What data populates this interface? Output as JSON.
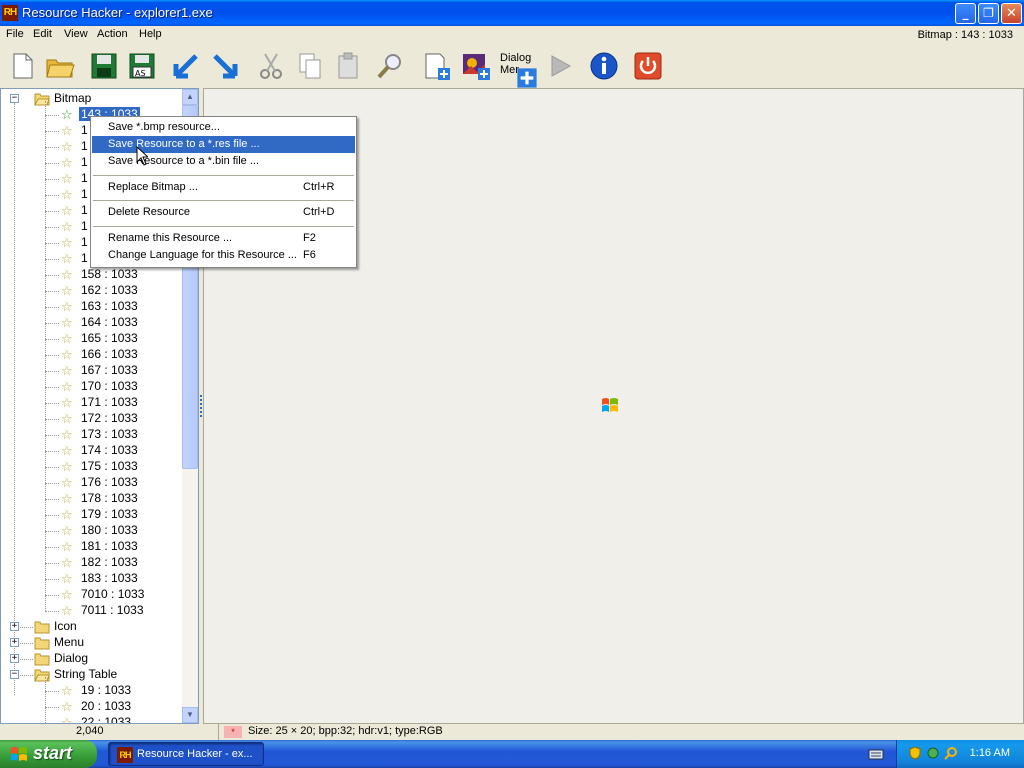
{
  "window": {
    "title": "Resource Hacker - explorer1.exe",
    "icon_text": "RH",
    "controls": {
      "minimize": "_",
      "maximize": "❐",
      "close": "✕"
    }
  },
  "menubar": {
    "items": [
      "File",
      "Edit",
      "View",
      "Action",
      "Help"
    ],
    "status": "Bitmap : 143 : 1033"
  },
  "toolbar": {
    "dialog_label_line1": "Dialog",
    "dialog_label_line2": "Mer"
  },
  "tree": {
    "root_folder": "Bitmap",
    "selected_item": "143 : 1033",
    "bitmap_items_visible": [
      "158 : 1033",
      "162 : 1033",
      "163 : 1033",
      "164 : 1033",
      "165 : 1033",
      "166 : 1033",
      "167 : 1033",
      "170 : 1033",
      "171 : 1033",
      "172 : 1033",
      "173 : 1033",
      "174 : 1033",
      "175 : 1033",
      "176 : 1033",
      "178 : 1033",
      "179 : 1033",
      "180 : 1033",
      "181 : 1033",
      "182 : 1033",
      "183 : 1033",
      "7010 : 1033",
      "7011 : 1033"
    ],
    "partially_hidden_prefixes": [
      "1",
      "1",
      "1",
      "1",
      "1",
      "1",
      "1",
      "1",
      "1"
    ],
    "folders": [
      "Icon",
      "Menu",
      "Dialog",
      "String Table"
    ],
    "string_table_items": [
      "19 : 1033",
      "20 : 1033",
      "22 : 1033"
    ]
  },
  "context_menu": {
    "items": [
      {
        "label": "Save *.bmp resource...",
        "shortcut": ""
      },
      {
        "label": "Save Resource to a *.res file ...",
        "shortcut": "",
        "highlighted": true
      },
      {
        "label": "Save Resource to a *.bin file ...",
        "shortcut": ""
      },
      {
        "label": "Replace Bitmap ...",
        "shortcut": "Ctrl+R"
      },
      {
        "label": "Delete Resource",
        "shortcut": "Ctrl+D"
      },
      {
        "label": "Rename this Resource ...",
        "shortcut": "F2"
      },
      {
        "label": "Change Language for this Resource ...",
        "shortcut": "F6"
      }
    ]
  },
  "statusbar": {
    "count": "2,040",
    "error_glyph": "*",
    "info": "Size: 25 × 20;  bpp:32;  hdr:v1;  type:RGB"
  },
  "taskbar": {
    "start_label": "start",
    "task_label": "Resource Hacker - ex...",
    "task_icon_text": "RH",
    "clock": "1:16 AM"
  },
  "colors": {
    "selection": "#316ac5",
    "titlebar": "#0053ee",
    "start_green": "#3c9e3c"
  }
}
